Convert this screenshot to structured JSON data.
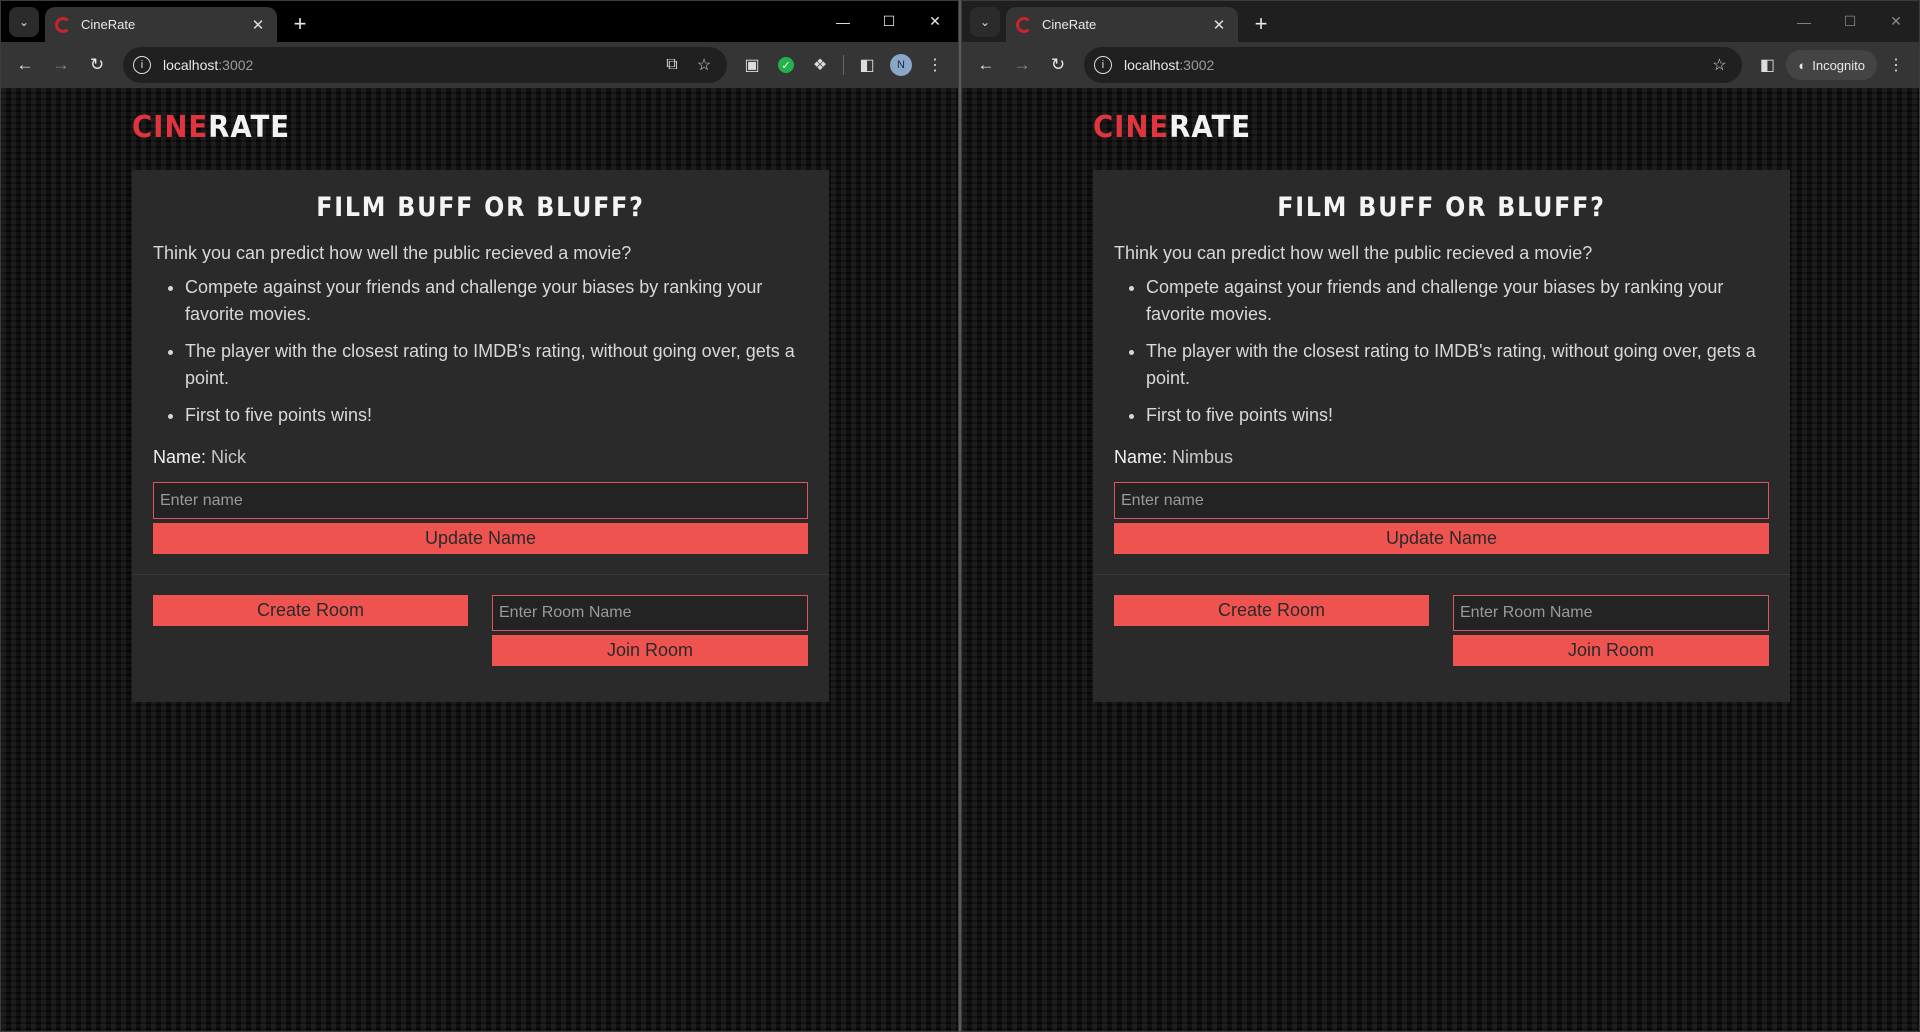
{
  "windows": [
    {
      "variant": "normal",
      "tab": {
        "title": "CineRate"
      },
      "url": {
        "host": "localhost",
        "port": ":3002"
      },
      "avatar_initial": "N",
      "incognito_label": "",
      "app": {
        "logo_red": "CINE",
        "logo_white": "RATE",
        "heading": "FILM BUFF OR BLUFF?",
        "intro": "Think you can predict how well the public recieved a movie?",
        "rules": [
          "Compete against your friends and challenge your biases by ranking your favorite movies.",
          "The player with the closest rating to IMDB's rating, without going over, gets a point.",
          "First to five points wins!"
        ],
        "name_label": "Name:",
        "name_value": "Nick",
        "name_placeholder": "Enter name",
        "update_label": "Update Name",
        "create_label": "Create Room",
        "room_placeholder": "Enter Room Name",
        "join_label": "Join Room"
      }
    },
    {
      "variant": "incognito",
      "tab": {
        "title": "CineRate"
      },
      "url": {
        "host": "localhost",
        "port": ":3002"
      },
      "avatar_initial": "",
      "incognito_label": "Incognito",
      "app": {
        "logo_red": "CINE",
        "logo_white": "RATE",
        "heading": "FILM BUFF OR BLUFF?",
        "intro": "Think you can predict how well the public recieved a movie?",
        "rules": [
          "Compete against your friends and challenge your biases by ranking your favorite movies.",
          "The player with the closest rating to IMDB's rating, without going over, gets a point.",
          "First to five points wins!"
        ],
        "name_label": "Name:",
        "name_value": "Nimbus",
        "name_placeholder": "Enter name",
        "update_label": "Update Name",
        "create_label": "Create Room",
        "room_placeholder": "Enter Room Name",
        "join_label": "Join Room"
      }
    }
  ],
  "colors": {
    "accent": "#ef5350",
    "logo_red": "#e0343f",
    "card_bg": "#2a2a2a"
  }
}
